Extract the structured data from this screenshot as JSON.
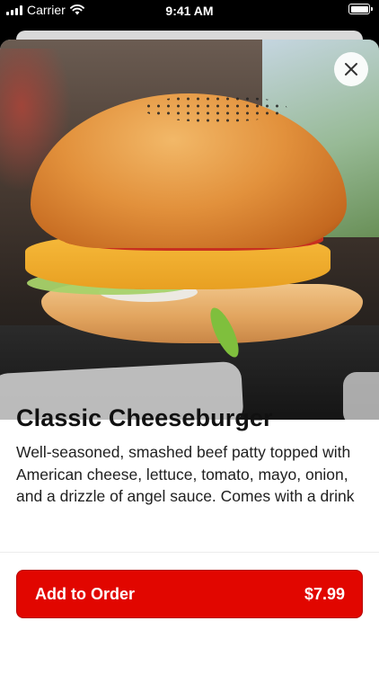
{
  "status_bar": {
    "carrier": "Carrier",
    "time": "9:41 AM"
  },
  "item": {
    "image_icon": "cheeseburger-photo",
    "name": "Classic Cheeseburger",
    "description": "Well-seasoned, smashed beef patty topped with American cheese, lettuce, tomato, mayo, onion, and a drizzle of angel sauce. Comes with a drink"
  },
  "close": {
    "icon": "close-icon"
  },
  "order": {
    "label": "Add to Order",
    "price": "$7.99"
  },
  "colors": {
    "accent": "#e10600"
  }
}
